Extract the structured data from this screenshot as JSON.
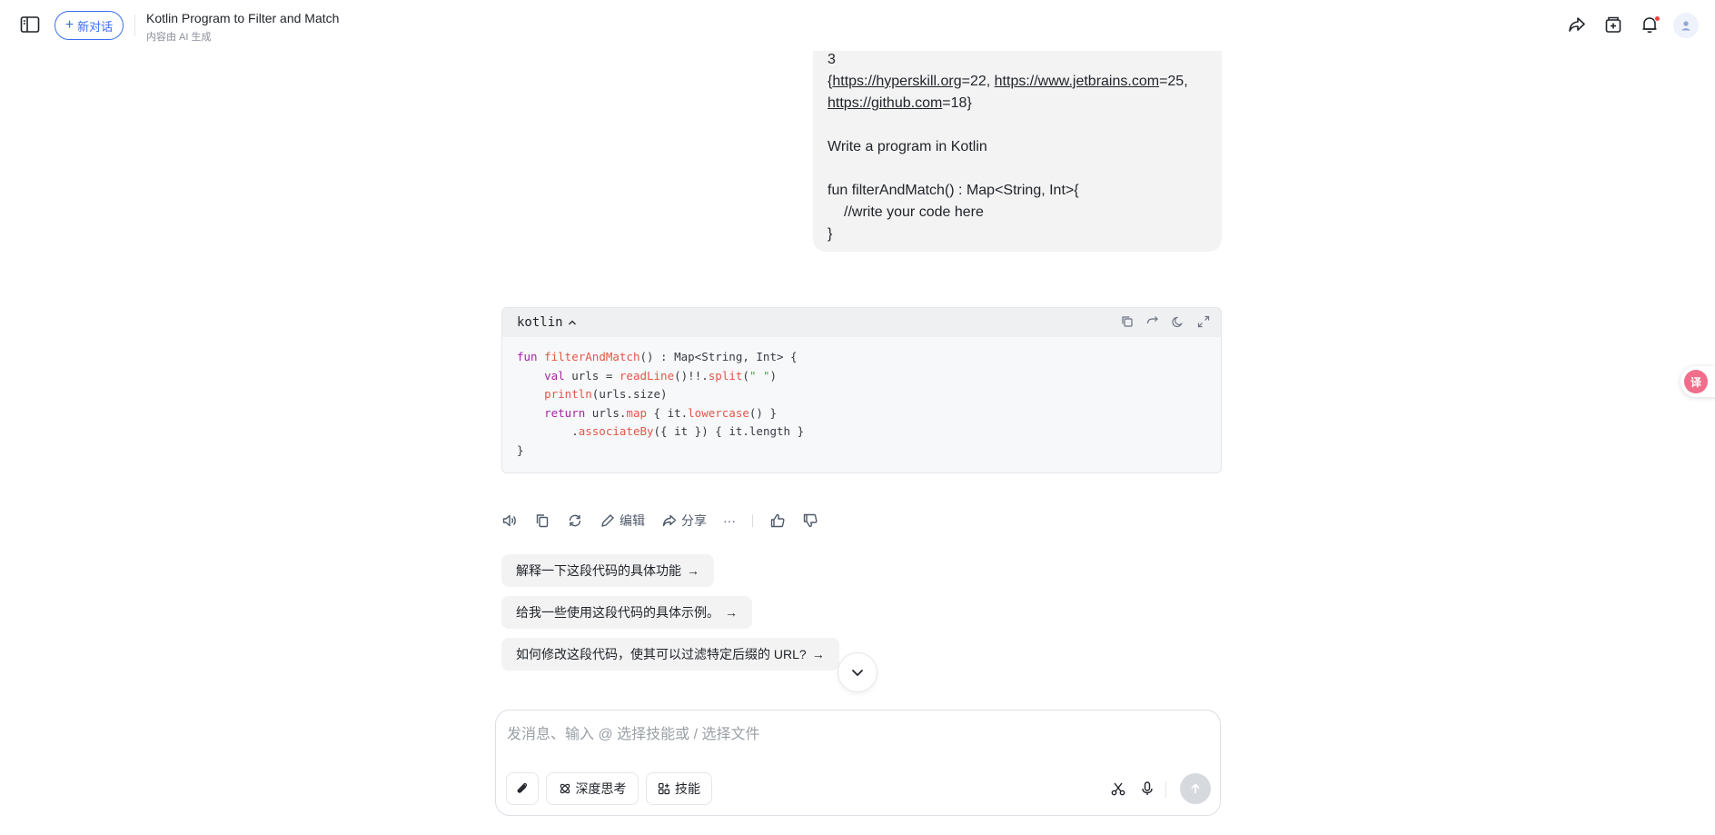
{
  "header": {
    "new_chat_label": "新对话",
    "title": "Kotlin Program to Filter and Match",
    "subtitle": "内容由 AI 生成"
  },
  "user_message": {
    "lines": [
      "3",
      "{https://hyperskill.org=22, https://www.jetbrains.com=25,",
      "https://github.com=18}",
      "",
      "Write a program in Kotlin",
      "",
      "fun filterAndMatch() : Map<String, Int>{",
      "//write your code here",
      "}"
    ],
    "links": [
      "https://hyperskill.org",
      "https://www.jetbrains.com",
      "https://github.com"
    ],
    "link_values": [
      "=22, ",
      "=25,",
      "=18}"
    ]
  },
  "code_block": {
    "language": "kotlin",
    "lines": [
      "fun filterAndMatch() : Map<String, Int> {",
      "    val urls = readLine()!!.split(\" \")",
      "    println(urls.size)",
      "    return urls.map { it.lowercase() }",
      "        .associateBy({ it }) { it.length }",
      "}"
    ]
  },
  "actions": {
    "edit_label": "编辑",
    "share_label": "分享",
    "more_label": "···"
  },
  "suggestions": [
    "解释一下这段代码的具体功能",
    "给我一些使用这段代码的具体示例。",
    "如何修改这段代码，使其可以过滤特定后缀的 URL?"
  ],
  "suggestion_arrow": "→",
  "input": {
    "placeholder": "发消息、输入 @ 选择技能或 / 选择文件",
    "deep_think_label": "深度思考",
    "skills_label": "技能"
  },
  "translate_icon_label": "译",
  "colors": {
    "accent": "#3a6df0",
    "notification_dot": "#f53f3f",
    "keyword": "#a626a4",
    "function": "#e45649",
    "string": "#50a14f"
  }
}
